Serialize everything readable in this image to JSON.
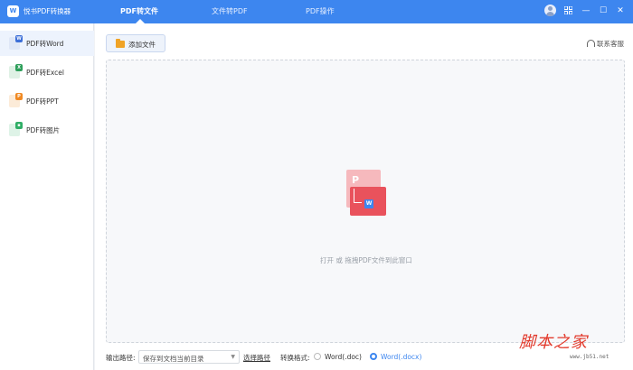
{
  "app": {
    "title": "悦书PDF转换器",
    "logo_glyph": "W",
    "accent_color": "#3d86ef"
  },
  "tabs": [
    {
      "label": "PDF转文件",
      "active": true
    },
    {
      "label": "文件转PDF",
      "active": false
    },
    {
      "label": "PDF操作",
      "active": false
    }
  ],
  "window_controls": {
    "avatar_icon": "user-avatar-icon",
    "grid_icon": "grid-icon",
    "minimize": "—",
    "maximize": "☐",
    "close": "✕"
  },
  "sidebar": {
    "items": [
      {
        "label": "PDF转Word",
        "badge": "W",
        "color": "#3d6fd8",
        "active": true
      },
      {
        "label": "PDF转Excel",
        "badge": "X",
        "color": "#2e9f5b",
        "active": false
      },
      {
        "label": "PDF转PPT",
        "badge": "P",
        "color": "#f08a24",
        "active": false
      },
      {
        "label": "PDF转图片",
        "badge": "▪",
        "color": "#2fae66",
        "active": false
      }
    ]
  },
  "toolbar": {
    "add_file_label": "添加文件",
    "service_label": "联系客服"
  },
  "dropzone": {
    "icon_letter": "P",
    "badge_letter": "W",
    "hint": "打开 或 拖拽PDF文件到此窗口"
  },
  "footer": {
    "output_path_label": "输出路径:",
    "output_path_value": "保存到文档当前目录",
    "choose_path_label": "选择路径",
    "format_label": "转换格式:",
    "formats": [
      {
        "label": "Word(.doc)",
        "selected": false
      },
      {
        "label": "Word(.docx)",
        "selected": true
      }
    ]
  },
  "watermark": {
    "text": "脚本之家",
    "url": "www.jb51.net"
  }
}
